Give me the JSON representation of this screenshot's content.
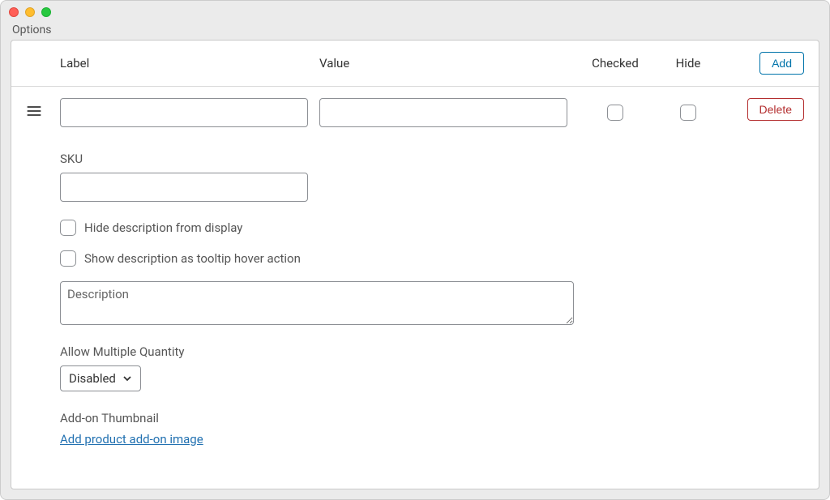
{
  "section_title": "Options",
  "headers": {
    "label": "Label",
    "value": "Value",
    "checked": "Checked",
    "hide": "Hide"
  },
  "buttons": {
    "add": "Add",
    "delete": "Delete"
  },
  "row": {
    "label_value": "",
    "value_value": ""
  },
  "details": {
    "sku_label": "SKU",
    "sku_value": "",
    "hide_desc_label": "Hide description from display",
    "tooltip_desc_label": "Show description as tooltip hover action",
    "description_placeholder": "Description",
    "description_value": "",
    "multi_qty_label": "Allow Multiple Quantity",
    "multi_qty_value": "Disabled",
    "thumbnail_label": "Add-on Thumbnail",
    "thumbnail_link": "Add product add-on image"
  }
}
